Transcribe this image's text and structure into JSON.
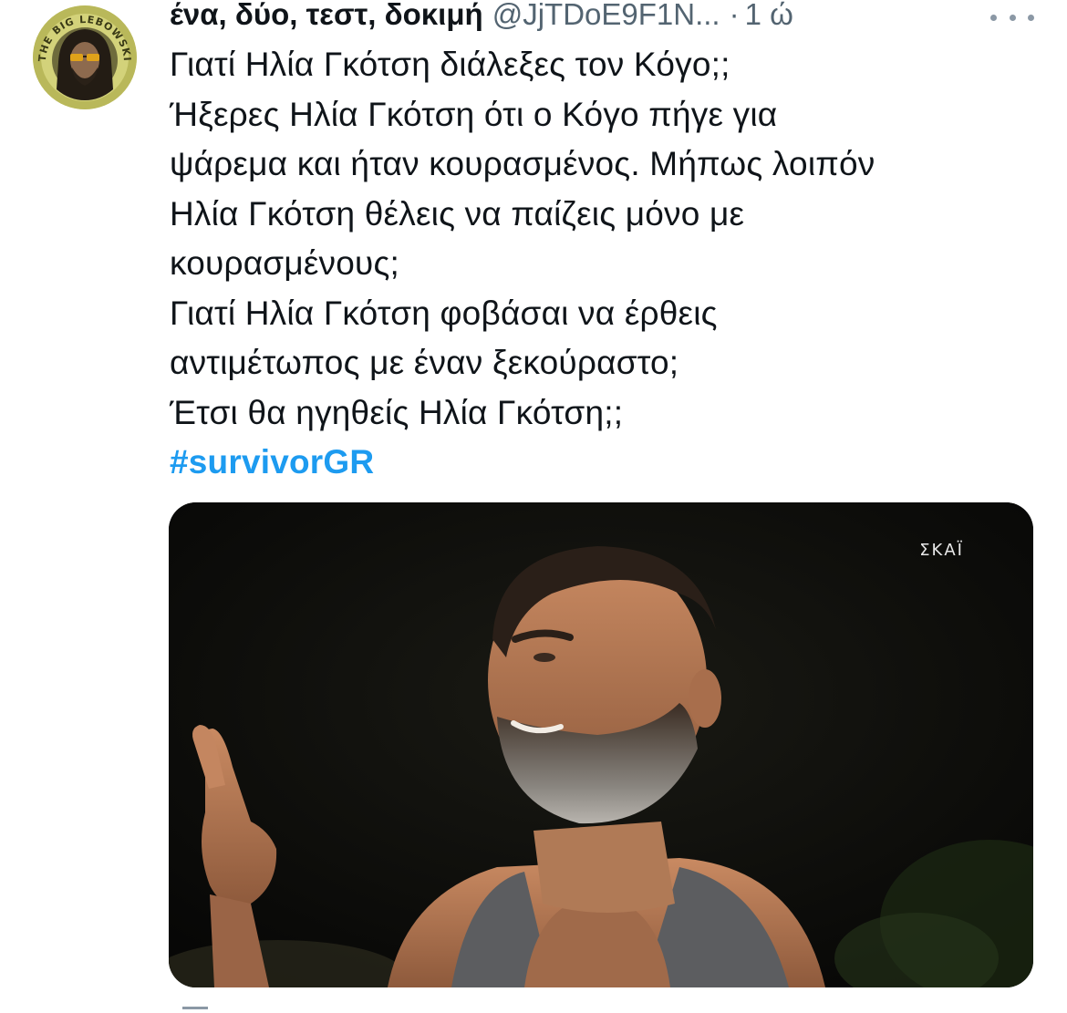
{
  "tweet": {
    "display_name": "ένα, δύο, τεστ, δοκιμή",
    "handle": "@JjTDoE9F1N...",
    "separator": "·",
    "time": "1 ώ",
    "more_icon": "more-horizontal-icon",
    "avatar_text": "THE BIG LEBOWSKI",
    "lines": [
      "Γιατί Ηλία Γκότση διάλεξες τον Κόγο;;",
      "Ήξερες Ηλία Γκότση ότι ο Κόγο πήγε για",
      "ψάρεμα και ήταν κουρασμένος. Μήπως λοιπόν",
      "Ηλία Γκότση θέλεις να παίζεις μόνο με",
      "κουρασμένους;",
      "Γιατί Ηλία Γκότση φοβάσαι να έρθεις",
      "αντιμέτωπος με έναν ξεκούραστο;",
      "Έτσι θα ηγηθείς Ηλία Γκότση;;"
    ],
    "hashtag": "#survivorGR",
    "media_watermark": "ΣΚΑΪ"
  },
  "colors": {
    "text": "#0f1419",
    "secondary": "#536471",
    "link": "#1d9bf0",
    "background": "#ffffff"
  }
}
